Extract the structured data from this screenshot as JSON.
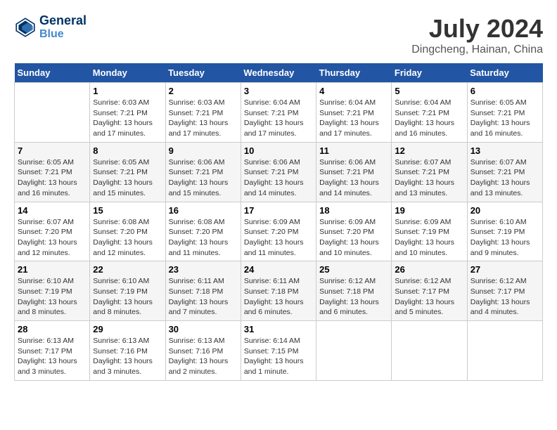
{
  "header": {
    "logo_line1": "General",
    "logo_line2": "Blue",
    "month_year": "July 2024",
    "location": "Dingcheng, Hainan, China"
  },
  "days_of_week": [
    "Sunday",
    "Monday",
    "Tuesday",
    "Wednesday",
    "Thursday",
    "Friday",
    "Saturday"
  ],
  "weeks": [
    [
      {
        "day": "",
        "sunrise": "",
        "sunset": "",
        "daylight": ""
      },
      {
        "day": "1",
        "sunrise": "6:03 AM",
        "sunset": "7:21 PM",
        "daylight": "13 hours and 17 minutes."
      },
      {
        "day": "2",
        "sunrise": "6:03 AM",
        "sunset": "7:21 PM",
        "daylight": "13 hours and 17 minutes."
      },
      {
        "day": "3",
        "sunrise": "6:04 AM",
        "sunset": "7:21 PM",
        "daylight": "13 hours and 17 minutes."
      },
      {
        "day": "4",
        "sunrise": "6:04 AM",
        "sunset": "7:21 PM",
        "daylight": "13 hours and 17 minutes."
      },
      {
        "day": "5",
        "sunrise": "6:04 AM",
        "sunset": "7:21 PM",
        "daylight": "13 hours and 16 minutes."
      },
      {
        "day": "6",
        "sunrise": "6:05 AM",
        "sunset": "7:21 PM",
        "daylight": "13 hours and 16 minutes."
      }
    ],
    [
      {
        "day": "7",
        "sunrise": "6:05 AM",
        "sunset": "7:21 PM",
        "daylight": "13 hours and 16 minutes."
      },
      {
        "day": "8",
        "sunrise": "6:05 AM",
        "sunset": "7:21 PM",
        "daylight": "13 hours and 15 minutes."
      },
      {
        "day": "9",
        "sunrise": "6:06 AM",
        "sunset": "7:21 PM",
        "daylight": "13 hours and 15 minutes."
      },
      {
        "day": "10",
        "sunrise": "6:06 AM",
        "sunset": "7:21 PM",
        "daylight": "13 hours and 14 minutes."
      },
      {
        "day": "11",
        "sunrise": "6:06 AM",
        "sunset": "7:21 PM",
        "daylight": "13 hours and 14 minutes."
      },
      {
        "day": "12",
        "sunrise": "6:07 AM",
        "sunset": "7:21 PM",
        "daylight": "13 hours and 13 minutes."
      },
      {
        "day": "13",
        "sunrise": "6:07 AM",
        "sunset": "7:21 PM",
        "daylight": "13 hours and 13 minutes."
      }
    ],
    [
      {
        "day": "14",
        "sunrise": "6:07 AM",
        "sunset": "7:20 PM",
        "daylight": "13 hours and 12 minutes."
      },
      {
        "day": "15",
        "sunrise": "6:08 AM",
        "sunset": "7:20 PM",
        "daylight": "13 hours and 12 minutes."
      },
      {
        "day": "16",
        "sunrise": "6:08 AM",
        "sunset": "7:20 PM",
        "daylight": "13 hours and 11 minutes."
      },
      {
        "day": "17",
        "sunrise": "6:09 AM",
        "sunset": "7:20 PM",
        "daylight": "13 hours and 11 minutes."
      },
      {
        "day": "18",
        "sunrise": "6:09 AM",
        "sunset": "7:20 PM",
        "daylight": "13 hours and 10 minutes."
      },
      {
        "day": "19",
        "sunrise": "6:09 AM",
        "sunset": "7:19 PM",
        "daylight": "13 hours and 10 minutes."
      },
      {
        "day": "20",
        "sunrise": "6:10 AM",
        "sunset": "7:19 PM",
        "daylight": "13 hours and 9 minutes."
      }
    ],
    [
      {
        "day": "21",
        "sunrise": "6:10 AM",
        "sunset": "7:19 PM",
        "daylight": "13 hours and 8 minutes."
      },
      {
        "day": "22",
        "sunrise": "6:10 AM",
        "sunset": "7:19 PM",
        "daylight": "13 hours and 8 minutes."
      },
      {
        "day": "23",
        "sunrise": "6:11 AM",
        "sunset": "7:18 PM",
        "daylight": "13 hours and 7 minutes."
      },
      {
        "day": "24",
        "sunrise": "6:11 AM",
        "sunset": "7:18 PM",
        "daylight": "13 hours and 6 minutes."
      },
      {
        "day": "25",
        "sunrise": "6:12 AM",
        "sunset": "7:18 PM",
        "daylight": "13 hours and 6 minutes."
      },
      {
        "day": "26",
        "sunrise": "6:12 AM",
        "sunset": "7:17 PM",
        "daylight": "13 hours and 5 minutes."
      },
      {
        "day": "27",
        "sunrise": "6:12 AM",
        "sunset": "7:17 PM",
        "daylight": "13 hours and 4 minutes."
      }
    ],
    [
      {
        "day": "28",
        "sunrise": "6:13 AM",
        "sunset": "7:17 PM",
        "daylight": "13 hours and 3 minutes."
      },
      {
        "day": "29",
        "sunrise": "6:13 AM",
        "sunset": "7:16 PM",
        "daylight": "13 hours and 3 minutes."
      },
      {
        "day": "30",
        "sunrise": "6:13 AM",
        "sunset": "7:16 PM",
        "daylight": "13 hours and 2 minutes."
      },
      {
        "day": "31",
        "sunrise": "6:14 AM",
        "sunset": "7:15 PM",
        "daylight": "13 hours and 1 minute."
      },
      {
        "day": "",
        "sunrise": "",
        "sunset": "",
        "daylight": ""
      },
      {
        "day": "",
        "sunrise": "",
        "sunset": "",
        "daylight": ""
      },
      {
        "day": "",
        "sunrise": "",
        "sunset": "",
        "daylight": ""
      }
    ]
  ]
}
